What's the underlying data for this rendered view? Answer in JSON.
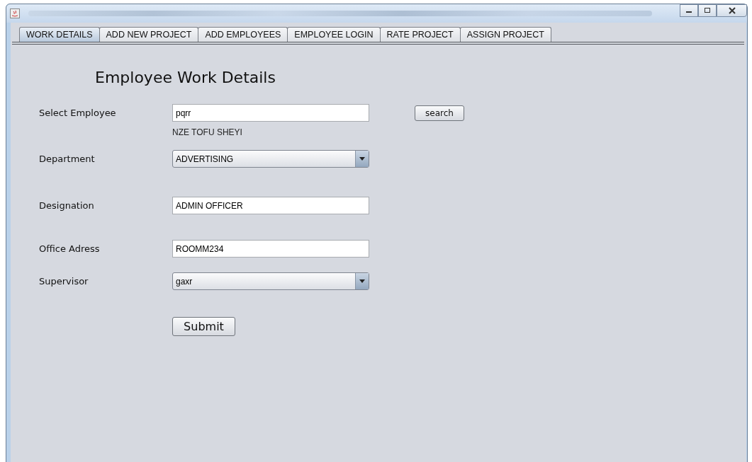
{
  "tabs": [
    {
      "label": "WORK DETAILS",
      "selected": true
    },
    {
      "label": "ADD NEW PROJECT",
      "selected": false
    },
    {
      "label": "ADD EMPLOYEES",
      "selected": false
    },
    {
      "label": "EMPLOYEE LOGIN",
      "selected": false
    },
    {
      "label": "RATE PROJECT",
      "selected": false
    },
    {
      "label": "ASSIGN PROJECT",
      "selected": false
    }
  ],
  "heading": "Employee Work Details",
  "fields": [
    {
      "kind": "text",
      "label": "Select Employee",
      "value": "pqrr",
      "button": "search",
      "note": "NZE TOFU SHEYI"
    },
    {
      "kind": "combo",
      "label": "Department",
      "value": "ADVERTISING"
    },
    {
      "kind": "text",
      "label": "Designation",
      "value": "ADMIN OFFICER"
    },
    {
      "kind": "text",
      "label": "Office Adress",
      "value": "ROOMM234"
    },
    {
      "kind": "combo",
      "label": "Supervisor",
      "value": "gaxr"
    }
  ],
  "submit": "Submit"
}
